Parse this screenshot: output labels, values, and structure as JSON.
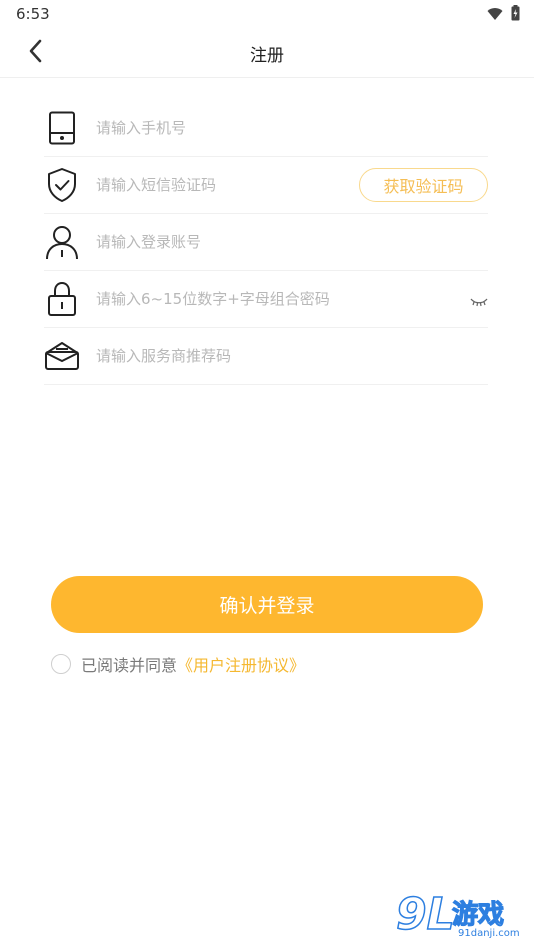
{
  "status_bar": {
    "time": "6:53"
  },
  "nav": {
    "title": "注册"
  },
  "form": {
    "phone": {
      "placeholder": "请输入手机号",
      "value": ""
    },
    "code": {
      "placeholder": "请输入短信验证码",
      "value": "",
      "button_label": "获取验证码"
    },
    "account": {
      "placeholder": "请输入登录账号",
      "value": ""
    },
    "password": {
      "placeholder": "请输入6~15位数字+字母组合密码",
      "value": ""
    },
    "referrer": {
      "placeholder": "请输入服务商推荐码",
      "value": ""
    }
  },
  "submit": {
    "label": "确认并登录"
  },
  "agreement": {
    "text": "已阅读并同意",
    "link": "《用户注册协议》",
    "checked": false
  },
  "watermark": {
    "logo": "9L",
    "name": "游戏",
    "url": "91danji.com"
  },
  "colors": {
    "accent": "#feb72f",
    "link": "#f5b831",
    "placeholder": "#b8b8b8",
    "divider": "#f0f0f0"
  },
  "icons": {
    "phone": "phone-icon",
    "code": "shield-check-icon",
    "account": "user-icon",
    "password": "lock-icon",
    "referrer": "envelope-icon",
    "eye": "eye-closed-icon",
    "back": "chevron-left-icon",
    "wifi": "wifi-icon",
    "battery": "battery-icon"
  }
}
